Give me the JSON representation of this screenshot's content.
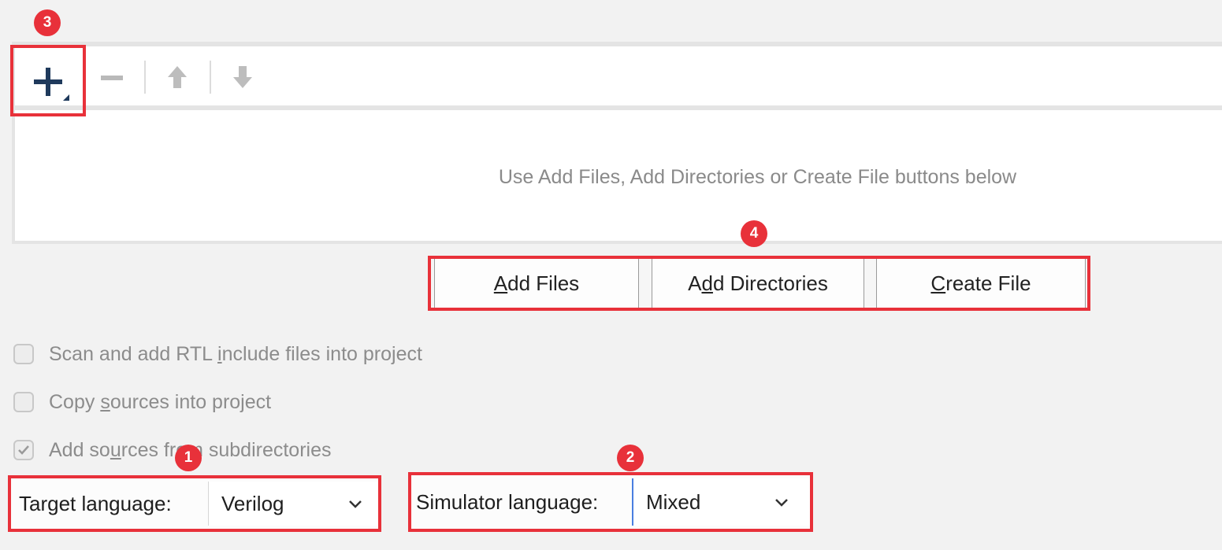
{
  "toolbar": {
    "add_icon": "plus-icon",
    "remove_icon": "minus-icon",
    "up_icon": "arrow-up-icon",
    "down_icon": "arrow-down-icon"
  },
  "file_list": {
    "empty_hint": "Use Add Files, Add Directories or Create File buttons below"
  },
  "actions": {
    "add_files": {
      "pre": "",
      "mnemonic": "A",
      "post": "dd Files"
    },
    "add_directories": {
      "pre": "A",
      "mnemonic": "d",
      "post": "d Directories"
    },
    "create_file": {
      "pre": "",
      "mnemonic": "C",
      "post": "reate File"
    }
  },
  "options": [
    {
      "pre": "Scan and add RTL ",
      "mnemonic": "i",
      "post": "nclude files into project",
      "checked": false
    },
    {
      "pre": "Copy ",
      "mnemonic": "s",
      "post": "ources into project",
      "checked": false
    },
    {
      "pre": "Add so",
      "mnemonic": "u",
      "post": "rces from subdirectories",
      "checked": true
    }
  ],
  "target_language": {
    "label": "Target language:",
    "value": "Verilog",
    "icon": "chevron-down-icon"
  },
  "simulator_language": {
    "label": "Simulator language:",
    "value": "Mixed",
    "icon": "chevron-down-icon"
  },
  "annotations": {
    "badge_1": "1",
    "badge_2": "2",
    "badge_3": "3",
    "badge_4": "4"
  },
  "colors": {
    "annotation_red": "#e8313a",
    "focus_blue": "#4a7fe0",
    "toolbar_blue": "#1f3a5c"
  }
}
